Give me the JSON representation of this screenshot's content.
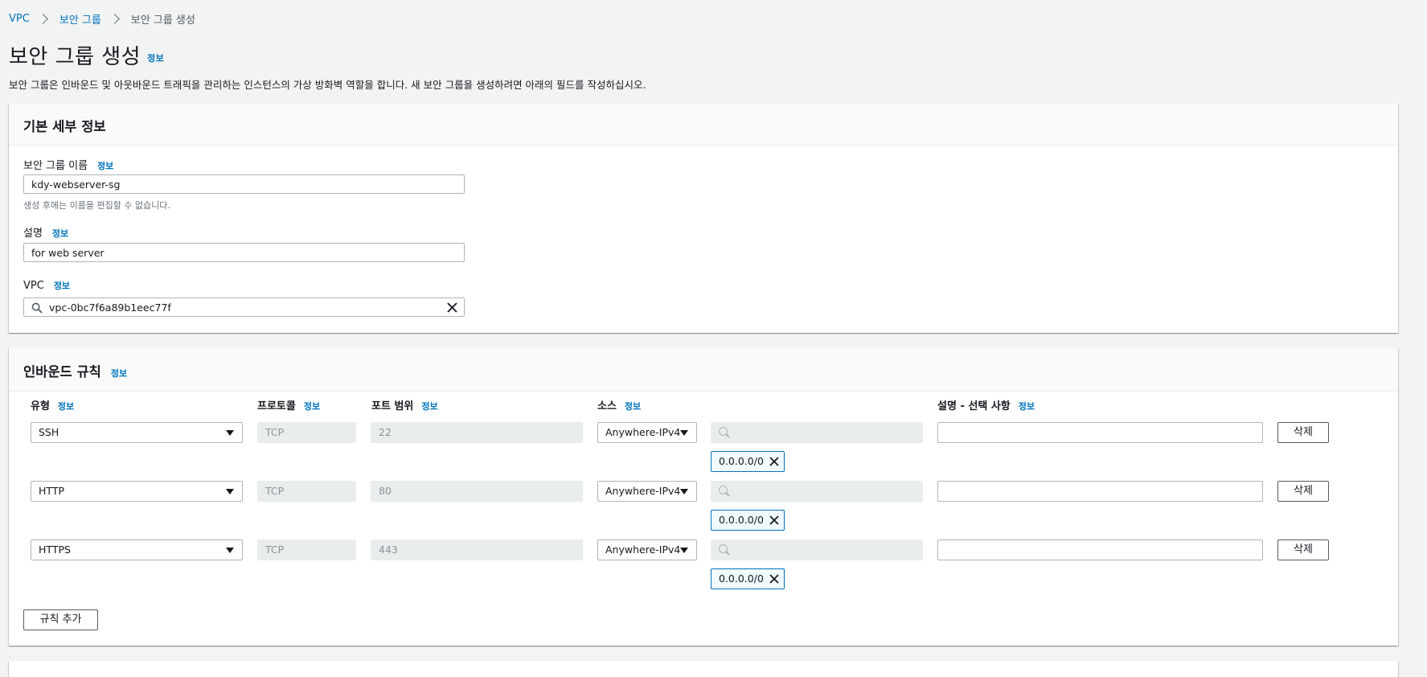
{
  "breadcrumb": {
    "items": [
      "VPC",
      "보안 그룹"
    ],
    "current": "보안 그룹 생성"
  },
  "page": {
    "title": "보안 그룹 생성",
    "info": "정보",
    "description": "보안 그룹은 인바운드 및 아웃바운드 트래픽을 관리하는 인스턴스의 가상 방화벽 역할을 합니다. 새 보안 그룹을 생성하려면 아래의 필드를 작성하십시오."
  },
  "basic": {
    "heading": "기본 세부 정보",
    "name_label": "보안 그룹 이름",
    "name_value": "kdy-webserver-sg",
    "name_hint": "생성 후에는 이름을 편집할 수 없습니다.",
    "desc_label": "설명",
    "desc_value": "for web server",
    "vpc_label": "VPC",
    "vpc_value": "vpc-0bc7f6a89b1eec77f"
  },
  "inbound": {
    "heading": "인바운드 규칙",
    "columns": {
      "type": "유형",
      "protocol": "프로토콜",
      "port": "포트 범위",
      "source": "소스",
      "description": "설명 - 선택 사항"
    },
    "rules": [
      {
        "type": "SSH",
        "protocol": "TCP",
        "port": "22",
        "source": "Anywhere-IPv4",
        "cidr": "0.0.0.0/0",
        "delete_label": "삭제"
      },
      {
        "type": "HTTP",
        "protocol": "TCP",
        "port": "80",
        "source": "Anywhere-IPv4",
        "cidr": "0.0.0.0/0",
        "delete_label": "삭제"
      },
      {
        "type": "HTTPS",
        "protocol": "TCP",
        "port": "443",
        "source": "Anywhere-IPv4",
        "cidr": "0.0.0.0/0",
        "delete_label": "삭제"
      }
    ],
    "add_rule_label": "규칙 추가"
  }
}
